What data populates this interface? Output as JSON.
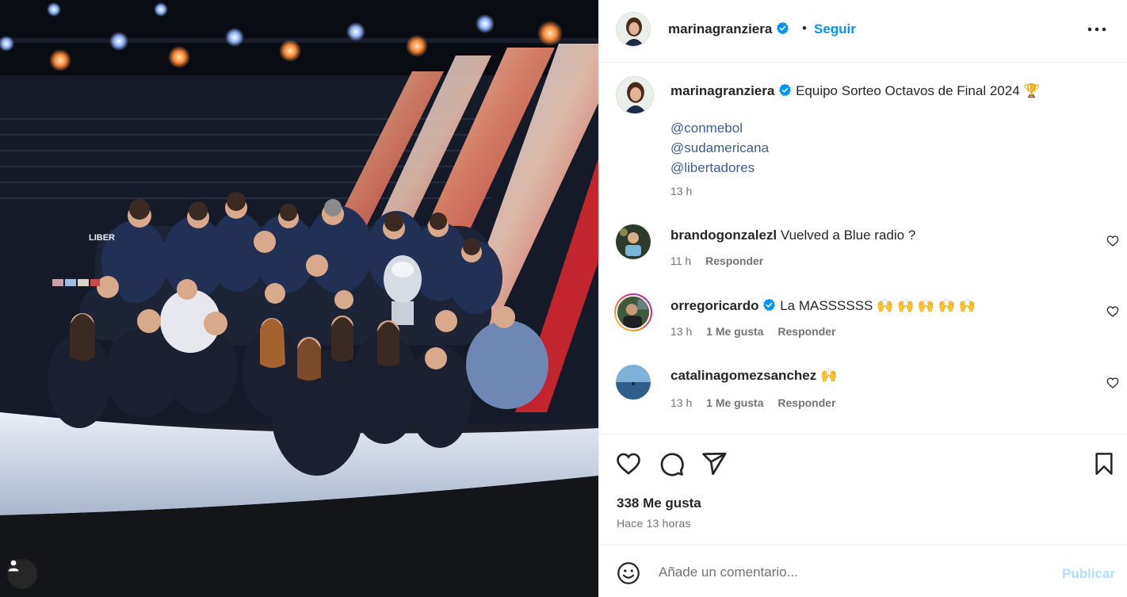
{
  "post": {
    "author": "marinagranziera",
    "follow_label": "Seguir",
    "separator": "•",
    "more_icon": "more-horizontal-icon"
  },
  "caption": {
    "author": "marinagranziera",
    "text": "Equipo Sorteo Octavos de Final 2024 🏆",
    "mentions": [
      "@conmebol",
      "@sudamericana",
      "@libertadores"
    ],
    "time": "13 h"
  },
  "comments": [
    {
      "user": "brandogonzalezl",
      "verified": false,
      "text": "Vuelved a Blue radio ?",
      "time": "11 h",
      "likes": "",
      "reply_label": "Responder"
    },
    {
      "user": "orregoricardo",
      "verified": true,
      "text": "La MASSSSSS 🙌 🙌 🙌 🙌 🙌",
      "time": "13 h",
      "likes": "1 Me gusta",
      "reply_label": "Responder"
    },
    {
      "user": "catalinagomezsanchez",
      "verified": false,
      "text": "🙌",
      "time": "13 h",
      "likes": "1 Me gusta",
      "reply_label": "Responder"
    }
  ],
  "actions": {
    "likes_text": "338 Me gusta",
    "posted_ago": "Hace 13 horas"
  },
  "composer": {
    "placeholder": "Añade un comentario...",
    "publish_label": "Publicar"
  },
  "colors": {
    "link_blue": "#0095f6",
    "mention_blue": "#3f5d8c",
    "muted_gray": "#737373",
    "verified_blue": "#0095f6",
    "publish_disabled": "#b3dbff"
  }
}
